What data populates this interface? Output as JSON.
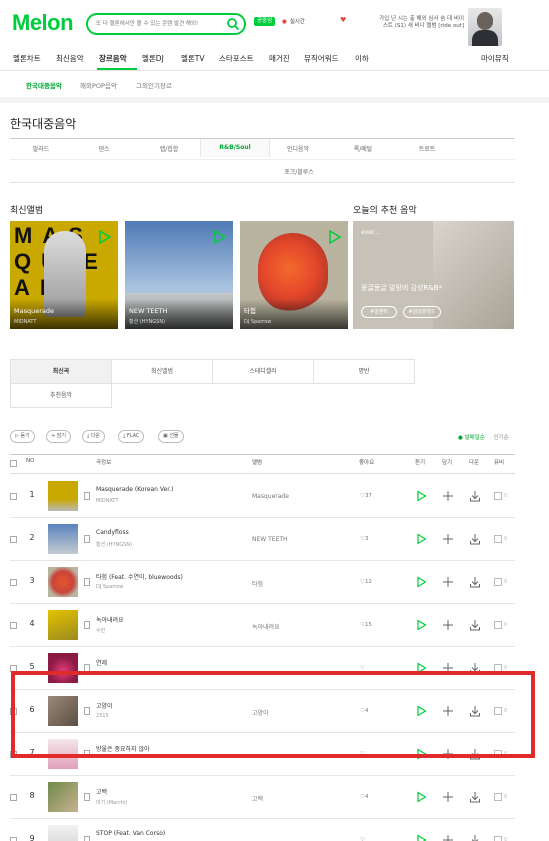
{
  "header": {
    "logo": "Melon",
    "search_placeholder": "또 더 멜론에서만 볼 수 있는 콘텐 발견 해외!",
    "badge": "공중엄",
    "realtime_label": "실시간",
    "promo_text": "가입 년 시는 출 해외 심사 숨 대 비이 스트 (S1) 새 비니 멜범 [ride out]"
  },
  "gnb": {
    "items": [
      "멜론차트",
      "최신음악",
      "장르음악",
      "멜론DJ",
      "멜론TV",
      "스타포스트",
      "매거진",
      "뮤직어워드",
      "이하"
    ],
    "right": "마이뮤직"
  },
  "subnav": [
    "한국대중음악",
    "해외POP음악",
    "그외인기장르"
  ],
  "page_title": "한국대중음악",
  "genres": [
    "발라드",
    "댄스",
    "랩/힙합",
    "R&B/Soul",
    "인디음악",
    "록/메탈",
    "트로트",
    "포크/블루스"
  ],
  "sections": {
    "new_albums": "최신앨범",
    "recommend": "오늘의 추천 음악"
  },
  "albums": [
    {
      "name": "Masquerade",
      "artist": "MIDNATT"
    },
    {
      "name": "NEW TEETH",
      "artist": "황션 (HYNGSN)"
    },
    {
      "name": "타험",
      "artist": "DJ Sparrow"
    }
  ],
  "recommend": {
    "logo": "ever...",
    "text": "몽글몽글 말랑비 감성R&B*",
    "buttons": [
      "#알앤비",
      "#감성발라드"
    ]
  },
  "chart_tabs": [
    "최신곡",
    "최신앨범",
    "스테디셀러",
    "명반",
    "추천음악"
  ],
  "toolbar": {
    "buttons": [
      "듣기",
      "담기",
      "다운",
      "FLAC",
      "선물"
    ],
    "sort": [
      "발매일순",
      "인기순"
    ]
  },
  "table_header": {
    "no": "NO",
    "song": "곡정보",
    "album": "앨범",
    "like": "좋아요",
    "listen": "듣기",
    "add": "담기",
    "down": "다운",
    "mv": "뮤비"
  },
  "songs": [
    {
      "rank": "1",
      "title": "Masquerade (Korean Ver.)",
      "artist": "MIDNATT",
      "album": "Masquerade",
      "likes": "37",
      "mv": "0"
    },
    {
      "rank": "2",
      "title": "Candyfloss",
      "artist": "황션 (HYNGSN)",
      "album": "NEW TEETH",
      "likes": "3",
      "mv": "0"
    },
    {
      "rank": "3",
      "title": "타험 (Feat. 수연이, bluewoods)",
      "artist": "DJ Sparrow",
      "album": "타험",
      "likes": "12",
      "mv": "0"
    },
    {
      "rank": "4",
      "title": "녹아내려요",
      "artist": "수헌",
      "album": "녹아내려요",
      "likes": "15",
      "mv": "0"
    },
    {
      "rank": "5",
      "title": "연제",
      "artist": "",
      "album": "",
      "likes": "",
      "mv": "0"
    },
    {
      "rank": "6",
      "title": "고양이",
      "artist": "2315",
      "album": "고양이",
      "likes": "4",
      "mv": "0"
    },
    {
      "rank": "7",
      "title": "방울은 중요하지 않아",
      "artist": "",
      "album": "",
      "likes": "",
      "mv": "0"
    },
    {
      "rank": "8",
      "title": "고백",
      "artist": "마기 (Marchi)",
      "album": "고백",
      "likes": "4",
      "mv": "0"
    },
    {
      "rank": "9",
      "title": "STOP (Feat. Van Corso)",
      "artist": "",
      "album": "",
      "likes": "",
      "mv": "0"
    }
  ],
  "colors": {
    "brand_green": "#00cd3c",
    "highlight_red": "#e02b2b"
  }
}
